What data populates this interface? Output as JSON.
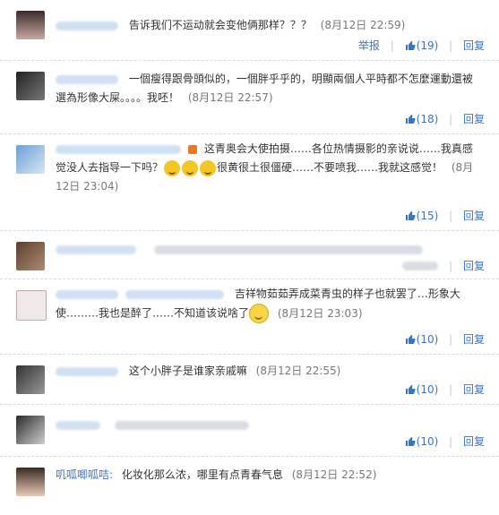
{
  "comments": [
    {
      "text": "告诉我们不运动就会变他俩那样？？？",
      "time": "(8月12日 22:59)",
      "report": "举报",
      "likes": "(19)",
      "reply": "回复"
    },
    {
      "text": "一個瘦得跟骨頭似的，一個胖乎乎的，明顯兩個人平時都不怎麼運動還被選為形像大屎。。。。我呸！",
      "time": "(8月12日 22:57)",
      "likes": "(18)",
      "reply": "回复"
    },
    {
      "text_a": "这青奥会大使拍摄……各位热情摄影的亲说说……我真感觉没人去指导一下吗？",
      "text_b": "很黄很土很僵硬……不要喷我……我就这感觉！",
      "time": "(8月12日 23:04)",
      "likes": "(15)",
      "reply": "回复"
    },
    {
      "reply": "回复"
    },
    {
      "text": "吉祥物茹茹弄成菜青虫的样子也就罢了…形象大使………我也是醉了……不知道该说啥了",
      "time": "(8月12日 23:03)",
      "likes": "(10)",
      "reply": "回复"
    },
    {
      "text": "这个小胖子是谁家亲戚嘛",
      "time": "(8月12日 22:55)",
      "likes": "(10)",
      "reply": "回复"
    },
    {
      "likes": "(10)",
      "reply": "回复"
    },
    {
      "username": "叽呱唧呱咭:",
      "text": "化妆化那么浓，哪里有点青春气息",
      "time": "(8月12日 22:52)"
    }
  ]
}
